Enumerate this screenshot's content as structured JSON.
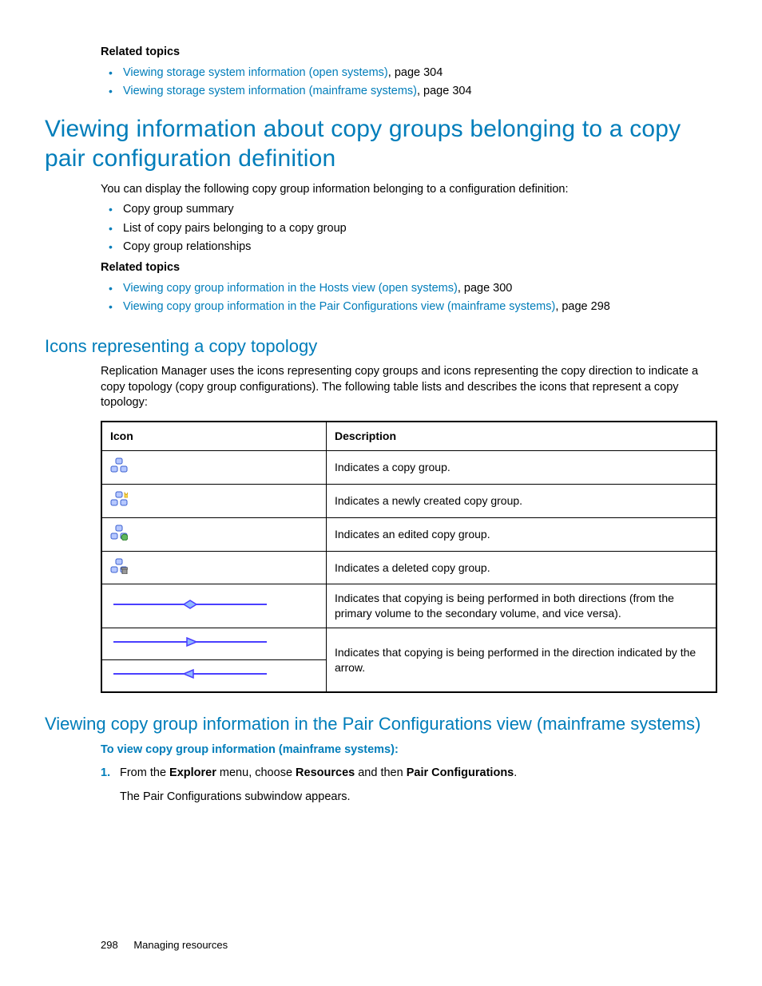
{
  "relatedTopics1": {
    "heading": "Related topics",
    "items": [
      {
        "link": "Viewing storage system information (open systems)",
        "tail": ", page 304"
      },
      {
        "link": "Viewing storage system information (mainframe systems)",
        "tail": ", page 304"
      }
    ]
  },
  "h1": "Viewing information about copy groups belonging to a copy pair configuration definition",
  "intro": "You can display the following copy group information belonging to a configuration definition:",
  "introList": [
    "Copy group summary",
    "List of copy pairs belonging to a copy group",
    "Copy group relationships"
  ],
  "relatedTopics2": {
    "heading": "Related topics",
    "items": [
      {
        "link": "Viewing copy group information in the Hosts view (open systems)",
        "tail": ", page 300"
      },
      {
        "link": "Viewing copy group information in the Pair Configurations view (mainframe systems)",
        "tail": ", page 298"
      }
    ]
  },
  "h2a": "Icons representing a copy topology",
  "h2a_para": "Replication Manager uses the icons representing copy groups and icons representing the copy direction to indicate a copy topology (copy group configurations). The following table lists and describes the icons that represent a copy topology:",
  "table": {
    "hIcon": "Icon",
    "hDesc": "Description",
    "rows": [
      {
        "icon": "group-basic",
        "desc": "Indicates a copy group."
      },
      {
        "icon": "group-new",
        "desc": "Indicates a newly created copy group."
      },
      {
        "icon": "group-edited",
        "desc": "Indicates an edited copy group."
      },
      {
        "icon": "group-deleted",
        "desc": "Indicates a deleted copy group."
      },
      {
        "icon": "arrow-both",
        "desc": "Indicates that copying is being performed in both directions (from the primary volume to the secondary volume, and vice versa)."
      },
      {
        "icon": "arrow-right",
        "desc": "Indicates that copying is being performed in the direction indicated by the arrow."
      },
      {
        "icon": "arrow-left",
        "desc": ""
      }
    ]
  },
  "h2b": "Viewing copy group information in the Pair Configurations view (mainframe systems)",
  "proc": {
    "heading": "To view copy group information (mainframe systems):",
    "step1": {
      "num": "1.",
      "pre": "From the ",
      "b1": "Explorer",
      "mid1": " menu, choose ",
      "b2": "Resources",
      "mid2": " and then ",
      "b3": "Pair Configurations",
      "post": ".",
      "result": "The Pair Configurations subwindow appears."
    }
  },
  "footer": {
    "page": "298",
    "title": "Managing resources"
  }
}
